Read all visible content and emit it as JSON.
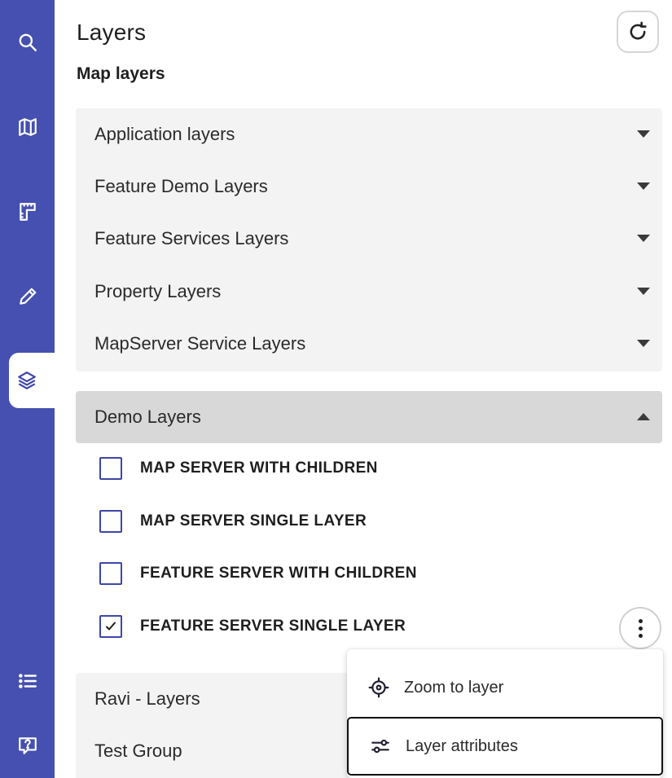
{
  "header": {
    "title": "Layers",
    "subtitle": "Map layers"
  },
  "rail": {
    "items": [
      {
        "icon": "search-icon"
      },
      {
        "icon": "map-icon"
      },
      {
        "icon": "measure-icon"
      },
      {
        "icon": "pencil-icon"
      },
      {
        "icon": "layers-icon",
        "active": true
      },
      {
        "icon": "list-icon"
      },
      {
        "icon": "help-icon"
      }
    ]
  },
  "groups": [
    {
      "label": "Application layers"
    },
    {
      "label": "Feature Demo Layers"
    },
    {
      "label": "Feature Services Layers"
    },
    {
      "label": "Property Layers"
    },
    {
      "label": "MapServer Service Layers"
    }
  ],
  "demo": {
    "label": "Demo Layers",
    "expanded": true,
    "layers": [
      {
        "label": "MAP SERVER WITH CHILDREN",
        "checked": false
      },
      {
        "label": "MAP SERVER SINGLE LAYER",
        "checked": false
      },
      {
        "label": "FEATURE SERVER WITH CHILDREN",
        "checked": false
      },
      {
        "label": "FEATURE SERVER SINGLE LAYER",
        "checked": true
      }
    ]
  },
  "lower_groups": [
    {
      "label": "Ravi - Layers"
    },
    {
      "label": "Test Group"
    }
  ],
  "menu": {
    "items": [
      {
        "label": "Zoom to layer",
        "icon": "crosshair-icon"
      },
      {
        "label": "Layer attributes",
        "icon": "sliders-icon",
        "focused": true
      }
    ]
  },
  "colors": {
    "rail": "#4650b0",
    "accent": "#3d46a8",
    "panel": "#f3f3f3",
    "expanded_header": "#d8d8d8"
  }
}
